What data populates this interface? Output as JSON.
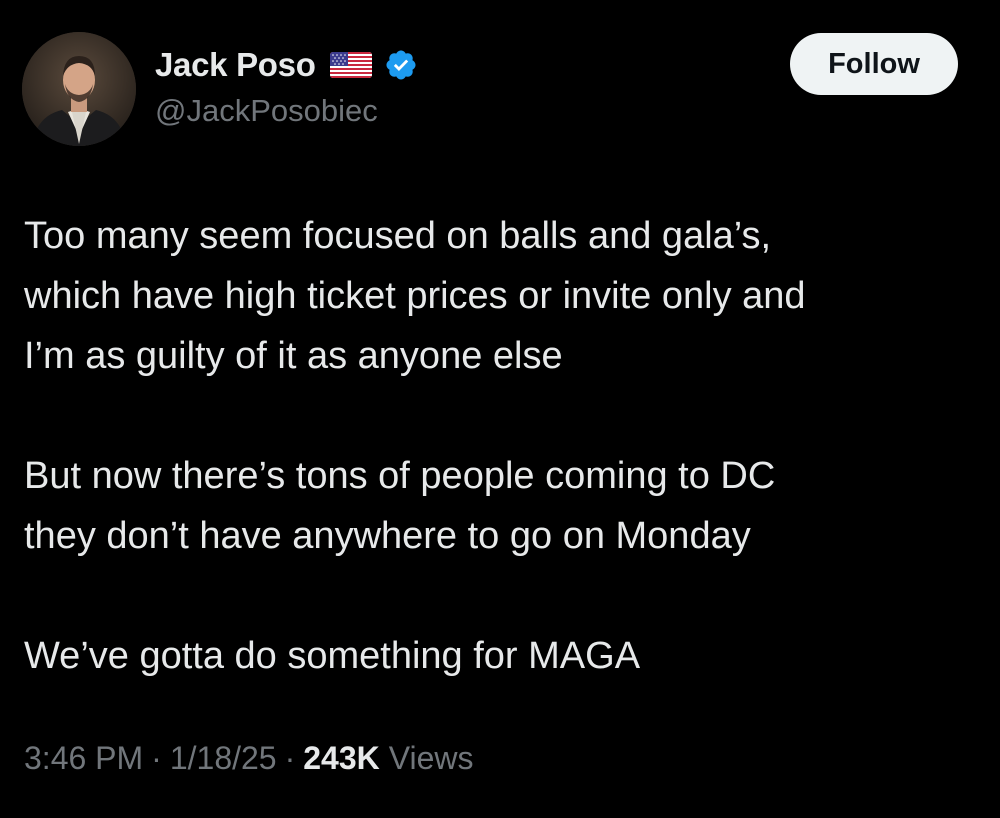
{
  "author": {
    "display_name": "Jack Poso",
    "handle": "@JackPosobiec",
    "flag": "us-flag-icon",
    "verified": true,
    "verified_color": "#1d9bf0"
  },
  "actions": {
    "follow_label": "Follow"
  },
  "tweet": {
    "paragraphs": [
      {
        "lines": [
          "Too many seem focused on balls and gala’s,",
          "which have high ticket prices or invite only and",
          "I’m as guilty of it as anyone else"
        ]
      },
      {
        "lines": [
          "But now there’s tons of people coming to DC",
          "they don’t have anywhere to go on Monday"
        ]
      },
      {
        "lines": [
          "We’ve gotta do something for MAGA"
        ]
      }
    ]
  },
  "meta": {
    "time": "3:46 PM",
    "date": "1/18/25",
    "separator": "·",
    "views_count": "243K",
    "views_label": "Views"
  },
  "colors": {
    "background": "#000000",
    "primary_text": "#e7e9ea",
    "secondary_text": "#71767b",
    "follow_bg": "#eff3f4",
    "follow_text": "#0f1419"
  }
}
